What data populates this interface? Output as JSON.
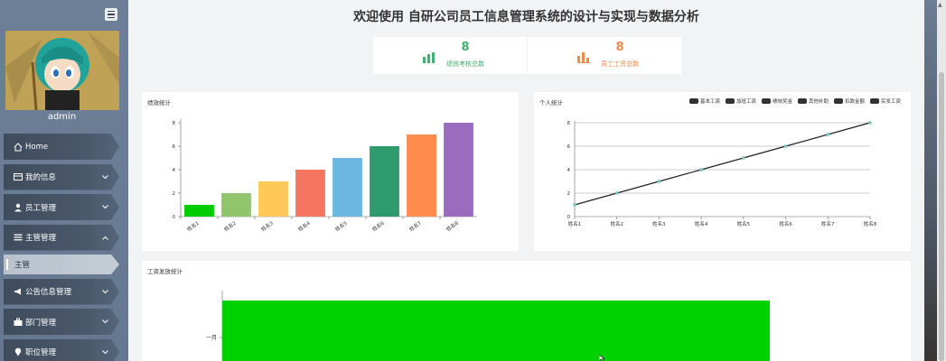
{
  "sidebar": {
    "username": "admin",
    "menu": [
      {
        "label": "Home",
        "icon": "home-icon",
        "chevron": false
      },
      {
        "label": "我的信息",
        "icon": "card-icon",
        "chevron": "down"
      },
      {
        "label": "员工管理",
        "icon": "user-icon",
        "chevron": "down"
      },
      {
        "label": "主管管理",
        "icon": "list-icon",
        "chevron": "up"
      },
      {
        "label": "主管",
        "icon": "",
        "chevron": false,
        "sub": true
      },
      {
        "label": "公告信息管理",
        "icon": "megaphone-icon",
        "chevron": "down"
      },
      {
        "label": "部门管理",
        "icon": "briefcase-icon",
        "chevron": "down"
      },
      {
        "label": "职位管理",
        "icon": "location-pin-icon",
        "chevron": "down"
      }
    ]
  },
  "header": {
    "title": "欢迎使用 自研公司员工信息管理系统的设计与实现与数据分析"
  },
  "stats": [
    {
      "value": "8",
      "label": "绩效考核总数",
      "color": "#3fae6e"
    },
    {
      "value": "8",
      "label": "员工工资总数",
      "color": "#f08a4b"
    }
  ],
  "charts": {
    "performance_title": "绩效统计",
    "personal_title": "个人统计",
    "salary_title": "工资发放统计"
  },
  "chart_data": [
    {
      "type": "bar",
      "title": "绩效统计",
      "categories": [
        "姓名1",
        "姓名2",
        "姓名3",
        "姓名4",
        "姓名5",
        "姓名6",
        "姓名7",
        "姓名8"
      ],
      "values": [
        1,
        2,
        3,
        4,
        5,
        6,
        7,
        8
      ],
      "colors": [
        "#00cc00",
        "#91c46c",
        "#ffc857",
        "#f47560",
        "#6cb7e0",
        "#2e9a6e",
        "#ff8c4c",
        "#9b6cbd"
      ],
      "yticks": [
        "0",
        "2",
        "4",
        "6",
        "8"
      ],
      "ylim": [
        0,
        8
      ]
    },
    {
      "type": "line",
      "title": "个人统计",
      "categories": [
        "姓名1",
        "姓名2",
        "姓名3",
        "姓名4",
        "姓名5",
        "姓名6",
        "姓名7",
        "姓名8"
      ],
      "legend": [
        "基本工资",
        "加班工资",
        "绩效奖金",
        "其他补助",
        "扣款金额",
        "实发工资"
      ],
      "legend_placement": "top-right",
      "values": [
        1,
        2,
        3,
        4,
        5,
        6,
        7,
        8
      ],
      "yticks": [
        "0",
        "2",
        "4",
        "6",
        "8"
      ],
      "ylim": [
        0,
        8
      ],
      "grid": true
    },
    {
      "type": "bar",
      "orientation": "horizontal",
      "title": "工资发放统计",
      "categories": [
        "一月"
      ],
      "color": "#00d100"
    }
  ]
}
